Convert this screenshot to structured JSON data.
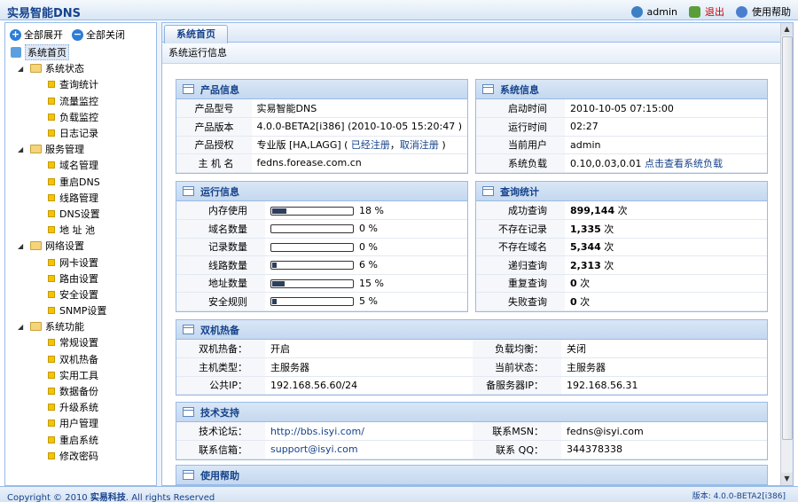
{
  "app": {
    "title": "实易智能DNS"
  },
  "topbar": {
    "user": "admin",
    "logout": "退出",
    "help": "使用帮助"
  },
  "sidebar": {
    "expand_all": "全部展开",
    "collapse_all": "全部关闭",
    "home": "系统首页",
    "groups": [
      {
        "label": "系统状态",
        "items": [
          "查询统计",
          "流量监控",
          "负载监控",
          "日志记录"
        ]
      },
      {
        "label": "服务管理",
        "items": [
          "域名管理",
          "重启DNS",
          "线路管理",
          "DNS设置",
          "地 址 池"
        ]
      },
      {
        "label": "网络设置",
        "items": [
          "网卡设置",
          "路由设置",
          "安全设置",
          "SNMP设置"
        ]
      },
      {
        "label": "系统功能",
        "items": [
          "常规设置",
          "双机热备",
          "实用工具",
          "数据备份",
          "升级系统",
          "用户管理",
          "重启系统",
          "修改密码"
        ]
      }
    ]
  },
  "main": {
    "tab": "系统首页",
    "section_title": "系统运行信息",
    "product": {
      "title": "产品信息",
      "rows": [
        {
          "label": "产品型号",
          "value": "实易智能DNS"
        },
        {
          "label": "产品版本",
          "value": "4.0.0-BETA2[i386] (2010-10-05 15:20:47 )"
        },
        {
          "label": "产品授权",
          "value": "专业版 [HA,LAGG] (",
          "link1": "已经注册",
          "sep": "，",
          "link2": "取消注册",
          "tail": ")"
        },
        {
          "label": "主 机 名",
          "value": "fedns.forease.com.cn"
        }
      ]
    },
    "system": {
      "title": "系统信息",
      "rows": [
        {
          "label": "启动时间",
          "value": "2010-10-05 07:15:00"
        },
        {
          "label": "运行时间",
          "value": "02:27"
        },
        {
          "label": "当前用户",
          "value": "admin"
        },
        {
          "label": "系统负载",
          "value": "0.10,0.03,0.01",
          "link": "点击查看系统负载"
        }
      ]
    },
    "running": {
      "title": "运行信息",
      "rows": [
        {
          "label": "内存使用",
          "text": "18 %",
          "pct": 18
        },
        {
          "label": "域名数量",
          "text": "0 %",
          "pct": 0
        },
        {
          "label": "记录数量",
          "text": "0 %",
          "pct": 0
        },
        {
          "label": "线路数量",
          "text": "6 %",
          "pct": 6
        },
        {
          "label": "地址数量",
          "text": "15 %",
          "pct": 15
        },
        {
          "label": "安全规则",
          "text": "5 %",
          "pct": 5
        }
      ]
    },
    "query": {
      "title": "查询统计",
      "unit": "次",
      "rows": [
        {
          "label": "成功查询",
          "value": "899,144"
        },
        {
          "label": "不存在记录",
          "value": "1,335"
        },
        {
          "label": "不存在域名",
          "value": "5,344"
        },
        {
          "label": "递归查询",
          "value": "2,313"
        },
        {
          "label": "重复查询",
          "value": "0"
        },
        {
          "label": "失败查询",
          "value": "0"
        }
      ]
    },
    "ha": {
      "title": "双机热备",
      "rows": [
        {
          "l1": "双机热备：",
          "v1": "开启",
          "l2": "负载均衡：",
          "v2": "关闭"
        },
        {
          "l1": "主机类型：",
          "v1": "主服务器",
          "l2": "当前状态：",
          "v2": "主服务器"
        },
        {
          "l1": "公共IP：",
          "v1": "192.168.56.60/24",
          "l2": "备服务器IP：",
          "v2": "192.168.56.31"
        }
      ]
    },
    "support": {
      "title": "技术支持",
      "rows": [
        {
          "l1": "技术论坛：",
          "v1": "http://bbs.isyi.com/",
          "l2": "联系MSN：",
          "v2": "fedns@isyi.com"
        },
        {
          "l1": "联系信箱：",
          "v1": "support@isyi.com",
          "l2": "联系 QQ：",
          "v2": "344378338"
        }
      ]
    },
    "help_title": "使用帮助"
  },
  "footer": {
    "copyright_prefix": "Copyright © 2010",
    "company": "实易科技",
    "copyright_suffix": ". All rights Reserved",
    "version": "版本: 4.0.0-BETA2[i386]"
  }
}
